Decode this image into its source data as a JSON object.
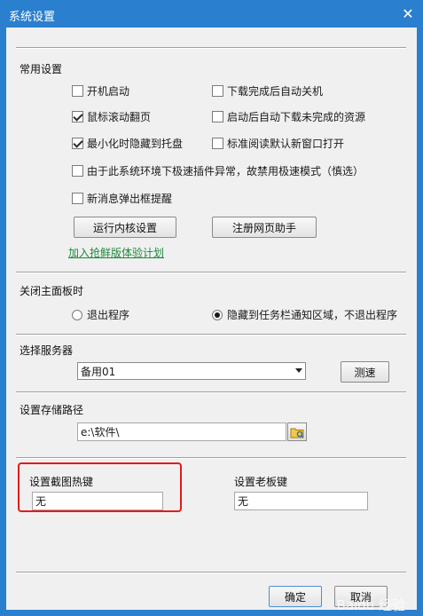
{
  "window": {
    "title": "系统设置"
  },
  "general": {
    "label": "常用设置",
    "options": [
      {
        "label": "开机启动",
        "checked": false
      },
      {
        "label": "下载完成后自动关机",
        "checked": false
      },
      {
        "label": "鼠标滚动翻页",
        "checked": true
      },
      {
        "label": "启动后自动下载未完成的资源",
        "checked": false
      },
      {
        "label": "最小化时隐藏到托盘",
        "checked": true
      },
      {
        "label": "标准阅读默认新窗口打开",
        "checked": false
      },
      {
        "label": "由于此系统环境下极速插件异常，故禁用极速模式（慎选）",
        "checked": false
      },
      {
        "label": "新消息弹出框提醒",
        "checked": false
      }
    ],
    "kernel_button": "运行内核设置",
    "webhelper_button": "注册网页助手",
    "join_link": "加入抢鲜版体验计划"
  },
  "close_panel": {
    "label": "关闭主面板时",
    "options": [
      {
        "label": "退出程序",
        "selected": false
      },
      {
        "label": "隐藏到任务栏通知区域，不退出程序",
        "selected": true
      }
    ]
  },
  "server": {
    "label": "选择服务器",
    "selected": "备用01",
    "test_button": "测速"
  },
  "storage": {
    "label": "设置存储路径",
    "path": "e:\\软件\\"
  },
  "hotkeys": {
    "screenshot_label": "设置截图热键",
    "screenshot_value": "无",
    "boss_label": "设置老板键",
    "boss_value": "无"
  },
  "footer": {
    "ok": "确定",
    "cancel": "取消"
  },
  "watermark": "Baidu 经验",
  "colors": {
    "titlebar": "#2a7fcf",
    "highlight": "#e31b1b",
    "link": "#1e8a3c"
  }
}
